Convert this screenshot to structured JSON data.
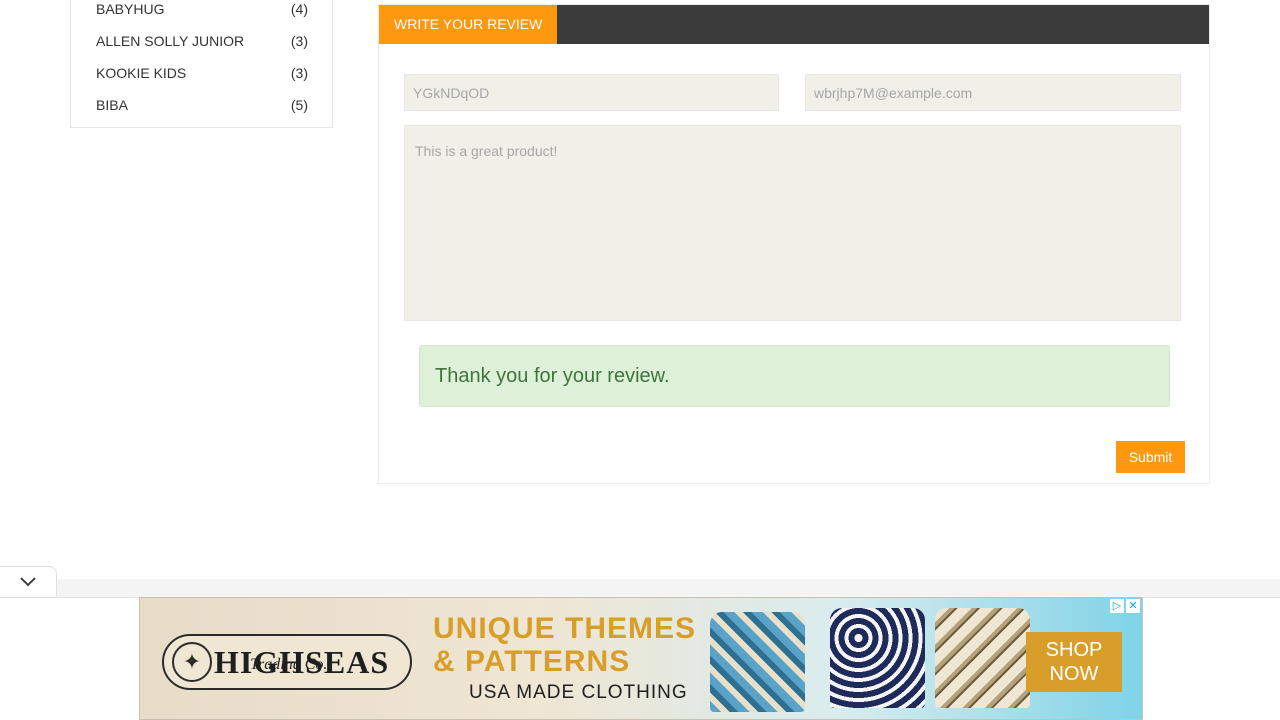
{
  "sidebar": {
    "brands": [
      {
        "name": "BABYHUG",
        "count": "(4)"
      },
      {
        "name": "ALLEN SOLLY JUNIOR",
        "count": "(3)"
      },
      {
        "name": "KOOKIE KIDS",
        "count": "(3)"
      },
      {
        "name": "BIBA",
        "count": "(5)"
      }
    ]
  },
  "review": {
    "tab_label": "WRITE YOUR REVIEW",
    "name_value": "YGkNDqOD",
    "email_value": "wbrjhp7M@example.com",
    "review_placeholder": "This is a great product!",
    "success_message": "Thank you for your review.",
    "submit_label": "Submit"
  },
  "ad": {
    "logo_text": "HIGHSEAS",
    "logo_sub": "Trading Co.",
    "headline_line1": "UNIQUE THEMES",
    "headline_line2": "& PATTERNS",
    "subline": "USA MADE CLOTHING",
    "cta_line1": "SHOP",
    "cta_line2": "NOW",
    "close_glyph": "✕",
    "adchoices_glyph": "▷"
  },
  "colors": {
    "accent": "#fe980f",
    "tabbar": "#3b3b3b",
    "input_bg": "#f0f0e9",
    "success_bg": "#dff0d8",
    "success_text": "#3c763d"
  }
}
